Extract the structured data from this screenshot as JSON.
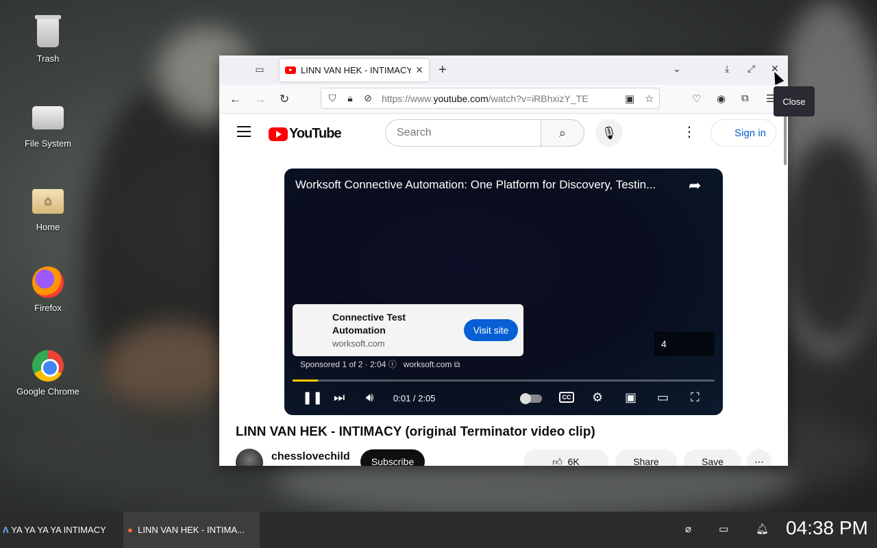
{
  "desktop": {
    "icons": [
      {
        "label": "Trash",
        "icon": "trash-icon"
      },
      {
        "label": "File System",
        "icon": "drive-icon"
      },
      {
        "label": "Home",
        "icon": "home-folder-icon"
      },
      {
        "label": "Firefox",
        "icon": "firefox-icon"
      },
      {
        "label": "Google Chrome",
        "icon": "chrome-icon"
      }
    ]
  },
  "browser": {
    "tab_title": "LINN VAN HEK - INTIMACY",
    "url_prefix": "https://www.",
    "url_domain": "youtube.com",
    "url_path": "/watch?v=iRBhxizY_TE",
    "tooltip": "Close"
  },
  "youtube": {
    "search_placeholder": "Search",
    "signin_label": "Sign in",
    "player": {
      "title": "Worksoft Connective Automation: One Platform for Discovery, Testin...",
      "ad_title": "Connective Test Automation",
      "ad_domain": "worksoft.com",
      "visit_label": "Visit site",
      "sponsored_text": "Sponsored 1 of 2 · 2:04",
      "sponsored_link": "worksoft.com",
      "skip_countdown": "4",
      "time": "0:01 / 2:05",
      "progress": 0.06
    },
    "video_title": "LINN VAN HEK - INTIMACY (original Terminator video clip)",
    "channel_name": "chesslovechild",
    "subscribe_label": "Subscribe",
    "like_count": "6K",
    "share_label": "Share",
    "save_label": "Save"
  },
  "taskbar": {
    "items": [
      {
        "label": "YA YA YA YA INTIMACY"
      },
      {
        "label": "LINN VAN HEK - INTIMA..."
      }
    ],
    "clock": "04:38 PM"
  },
  "colors": {
    "youtube_red": "#ff0000",
    "link_blue": "#065fd4",
    "visit_btn": "#065fd4",
    "progress_ad": "#ffcc00"
  }
}
